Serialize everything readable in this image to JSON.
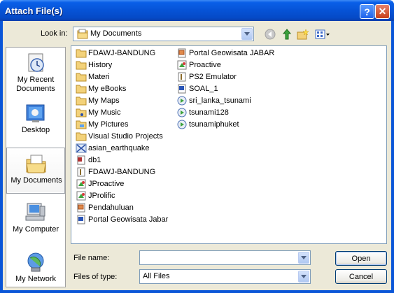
{
  "window": {
    "title": "Attach File(s)",
    "help_symbol": "?",
    "close_symbol": "✕"
  },
  "look_in": {
    "label": "Look in:",
    "value": "My Documents"
  },
  "toolbar": {
    "icons": [
      "back-icon",
      "up-folder-icon",
      "new-folder-icon",
      "views-menu-icon"
    ]
  },
  "places": [
    {
      "label": "My Recent Documents",
      "icon": "recent-documents-icon"
    },
    {
      "label": "Desktop",
      "icon": "desktop-icon"
    },
    {
      "label": "My Documents",
      "icon": "my-documents-icon",
      "selected": true
    },
    {
      "label": "My Computer",
      "icon": "my-computer-icon"
    },
    {
      "label": "My Network",
      "icon": "my-network-icon"
    }
  ],
  "files": {
    "column1": [
      {
        "name": "FDAWJ-BANDUNG",
        "icon": "folder-icon"
      },
      {
        "name": "History",
        "icon": "folder-icon"
      },
      {
        "name": "Materi",
        "icon": "folder-icon"
      },
      {
        "name": "My eBooks",
        "icon": "folder-icon"
      },
      {
        "name": "My Maps",
        "icon": "folder-icon"
      },
      {
        "name": "My Music",
        "icon": "music-folder-icon"
      },
      {
        "name": "My Pictures",
        "icon": "pictures-folder-icon"
      },
      {
        "name": "Visual Studio Projects",
        "icon": "folder-icon"
      },
      {
        "name": "asian_earthquake",
        "icon": "map-file-icon"
      },
      {
        "name": "db1",
        "icon": "access-file-icon"
      },
      {
        "name": "FDAWJ-BANDUNG",
        "icon": "text-file-icon"
      },
      {
        "name": "JProactive",
        "icon": "app-shortcut-icon"
      },
      {
        "name": "JProlific",
        "icon": "app-shortcut-icon"
      },
      {
        "name": "Pendahuluan",
        "icon": "powerpoint-file-icon"
      },
      {
        "name": "Portal Geowisata Jabar",
        "icon": "word-file-icon"
      }
    ],
    "column2": [
      {
        "name": "Portal Geowisata JABAR",
        "icon": "powerpoint-file-icon"
      },
      {
        "name": "Proactive",
        "icon": "app-shortcut-icon"
      },
      {
        "name": "PS2 Emulator",
        "icon": "text-file-icon"
      },
      {
        "name": "SOAL_1",
        "icon": "word-file-icon"
      },
      {
        "name": "sri_lanka_tsunami",
        "icon": "video-file-icon"
      },
      {
        "name": "tsunami128",
        "icon": "video-file-icon"
      },
      {
        "name": "tsunamiphuket",
        "icon": "video-file-icon"
      }
    ]
  },
  "file_name": {
    "label": "File name:",
    "value": ""
  },
  "file_type": {
    "label": "Files of type:",
    "value": "All Files"
  },
  "buttons": {
    "open": "Open",
    "cancel": "Cancel"
  }
}
